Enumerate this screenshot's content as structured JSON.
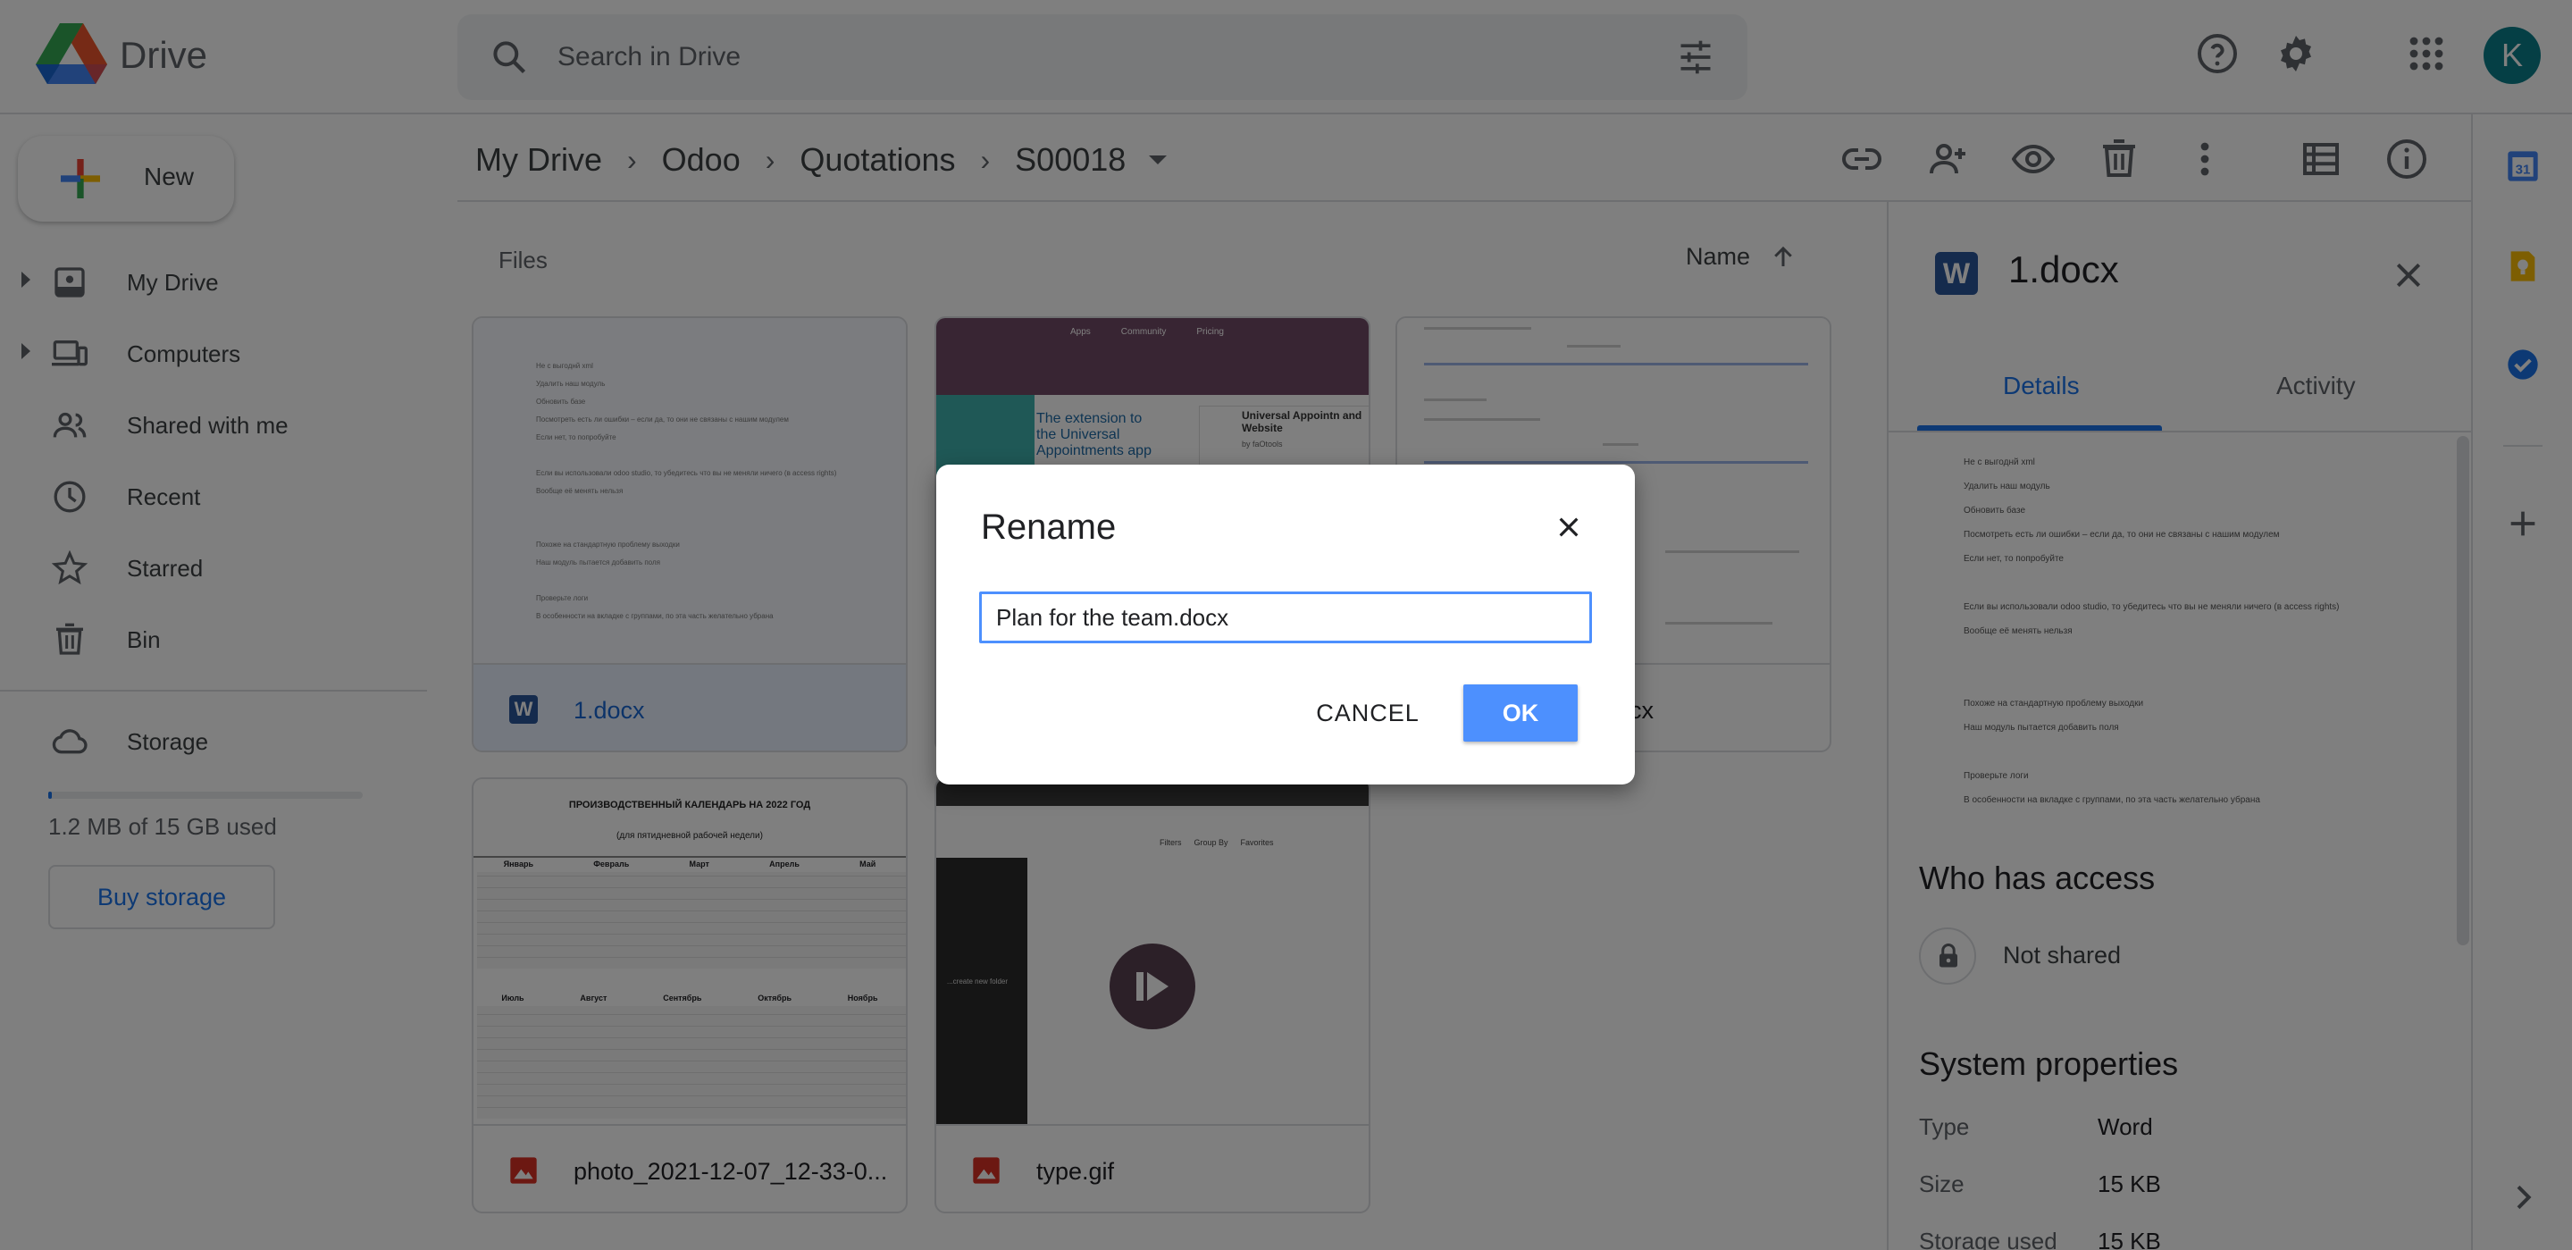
{
  "header": {
    "brand": "Drive",
    "search_placeholder": "Search in Drive",
    "avatar_letter": "K"
  },
  "sidebar": {
    "new_label": "New",
    "items": [
      {
        "label": "My Drive",
        "icon": "my-drive-icon"
      },
      {
        "label": "Computers",
        "icon": "computers-icon"
      },
      {
        "label": "Shared with me",
        "icon": "shared-icon"
      },
      {
        "label": "Recent",
        "icon": "clock-icon"
      },
      {
        "label": "Starred",
        "icon": "star-icon"
      },
      {
        "label": "Bin",
        "icon": "bin-icon"
      }
    ],
    "storage_label": "Storage",
    "storage_used_text": "1.2 MB of 15 GB used",
    "storage_fraction": 0.0001,
    "buy_storage_label": "Buy storage"
  },
  "breadcrumb": [
    "My Drive",
    "Odoo",
    "Quotations",
    "S00018"
  ],
  "main": {
    "section_label": "Files",
    "sort_label": "Name",
    "files": [
      {
        "name": "1.docx",
        "type": "word"
      },
      {
        "name": "",
        "type": "web"
      },
      {
        "name": "cx",
        "type": "word"
      },
      {
        "name": "photo_2021-12-07_12-33-0...",
        "type": "image"
      },
      {
        "name": "type.gif",
        "type": "image"
      }
    ],
    "doc_thumb_text": [
      "Не с выгоднй xml",
      "Удалить наш модуль",
      "Обновить базе",
      "Посмотреть есть ли ошибки – если да, то они не связаны с нашим модулем",
      "Если нет, то попробуйте",
      "Если вы использовали odoo studio, то убедитесь что вы не меняли ничего (в access rights)",
      "Вообще её менять нельзя",
      "Похоже на стандартную проблему выходки",
      "Наш модуль пытается добавить поля",
      "Проверьте логи",
      "В особенности на вкладке с группами, по эта часть желательно убрана"
    ],
    "web_thumb": {
      "nav": [
        "Apps",
        "Community",
        "Pricing"
      ],
      "headline": "The extension to the Universal Appointments app",
      "side_title": "Universal Appointn and Website",
      "side_sub": "by faOtools"
    },
    "calendar_thumb": {
      "title": "ПРОИЗВОДСТВЕННЫЙ КАЛЕНДАРЬ НА 2022 ГОД",
      "subtitle": "(для пятидневной рабочей недели)",
      "months_top": [
        "Январь",
        "Февраль",
        "Март",
        "Апрель",
        "Май"
      ],
      "months_bottom": [
        "Июль",
        "Август",
        "Сентябрь",
        "Октябрь",
        "Ноябрь"
      ]
    },
    "gif_thumb": {
      "caption": "...create new folder",
      "filters": [
        "Filters",
        "Group By",
        "Favorites"
      ]
    }
  },
  "details": {
    "title": "1.docx",
    "tabs": [
      "Details",
      "Activity"
    ],
    "who_has_access": "Who has access",
    "sharing_status": "Not shared",
    "system_properties": "System properties",
    "properties": [
      {
        "key": "Type",
        "value": "Word"
      },
      {
        "key": "Size",
        "value": "15 KB"
      },
      {
        "key": "Storage used",
        "value": "15 KB"
      }
    ]
  },
  "modal": {
    "title": "Rename",
    "input_value": "Plan for the team.docx",
    "cancel_label": "CANCEL",
    "ok_label": "OK"
  },
  "colors": {
    "accent": "#1a73e8",
    "ok_button": "#4d90fe",
    "word_blue": "#2b579a",
    "image_red": "#d93025",
    "avatar": "#0b7f8a"
  }
}
